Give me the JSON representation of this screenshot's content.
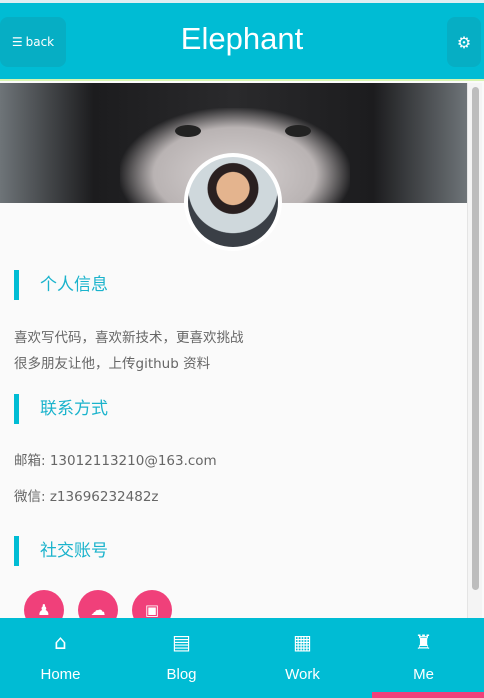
{
  "header": {
    "back_label": "back",
    "title": "Elephant",
    "back_icon": "list-icon",
    "settings_icon": "gear-icon"
  },
  "profile": {
    "banner": "banner-image",
    "avatar": "avatar-image"
  },
  "sections": [
    {
      "title": "个人信息",
      "lines": [
        "喜欢写代码，喜欢新技术，更喜欢挑战",
        "很多朋友让他，上传github 资料"
      ]
    },
    {
      "title": "联系方式",
      "lines": [
        "邮箱: 13012113210@163.com",
        "微信: z13696232482z"
      ]
    },
    {
      "title": "社交账号"
    }
  ],
  "social": [
    {
      "icon": "qq-icon",
      "glyph": "♟"
    },
    {
      "icon": "wechat-icon",
      "glyph": "☁"
    },
    {
      "icon": "twitter-icon",
      "glyph": "▣"
    }
  ],
  "nav": [
    {
      "label": "Home",
      "glyph": "⌂"
    },
    {
      "label": "Blog",
      "glyph": "▤"
    },
    {
      "label": "Work",
      "glyph": "▦"
    },
    {
      "label": "Me",
      "glyph": "♜"
    }
  ],
  "colors": {
    "accent": "#00bcd4",
    "pink": "#f0407a"
  }
}
